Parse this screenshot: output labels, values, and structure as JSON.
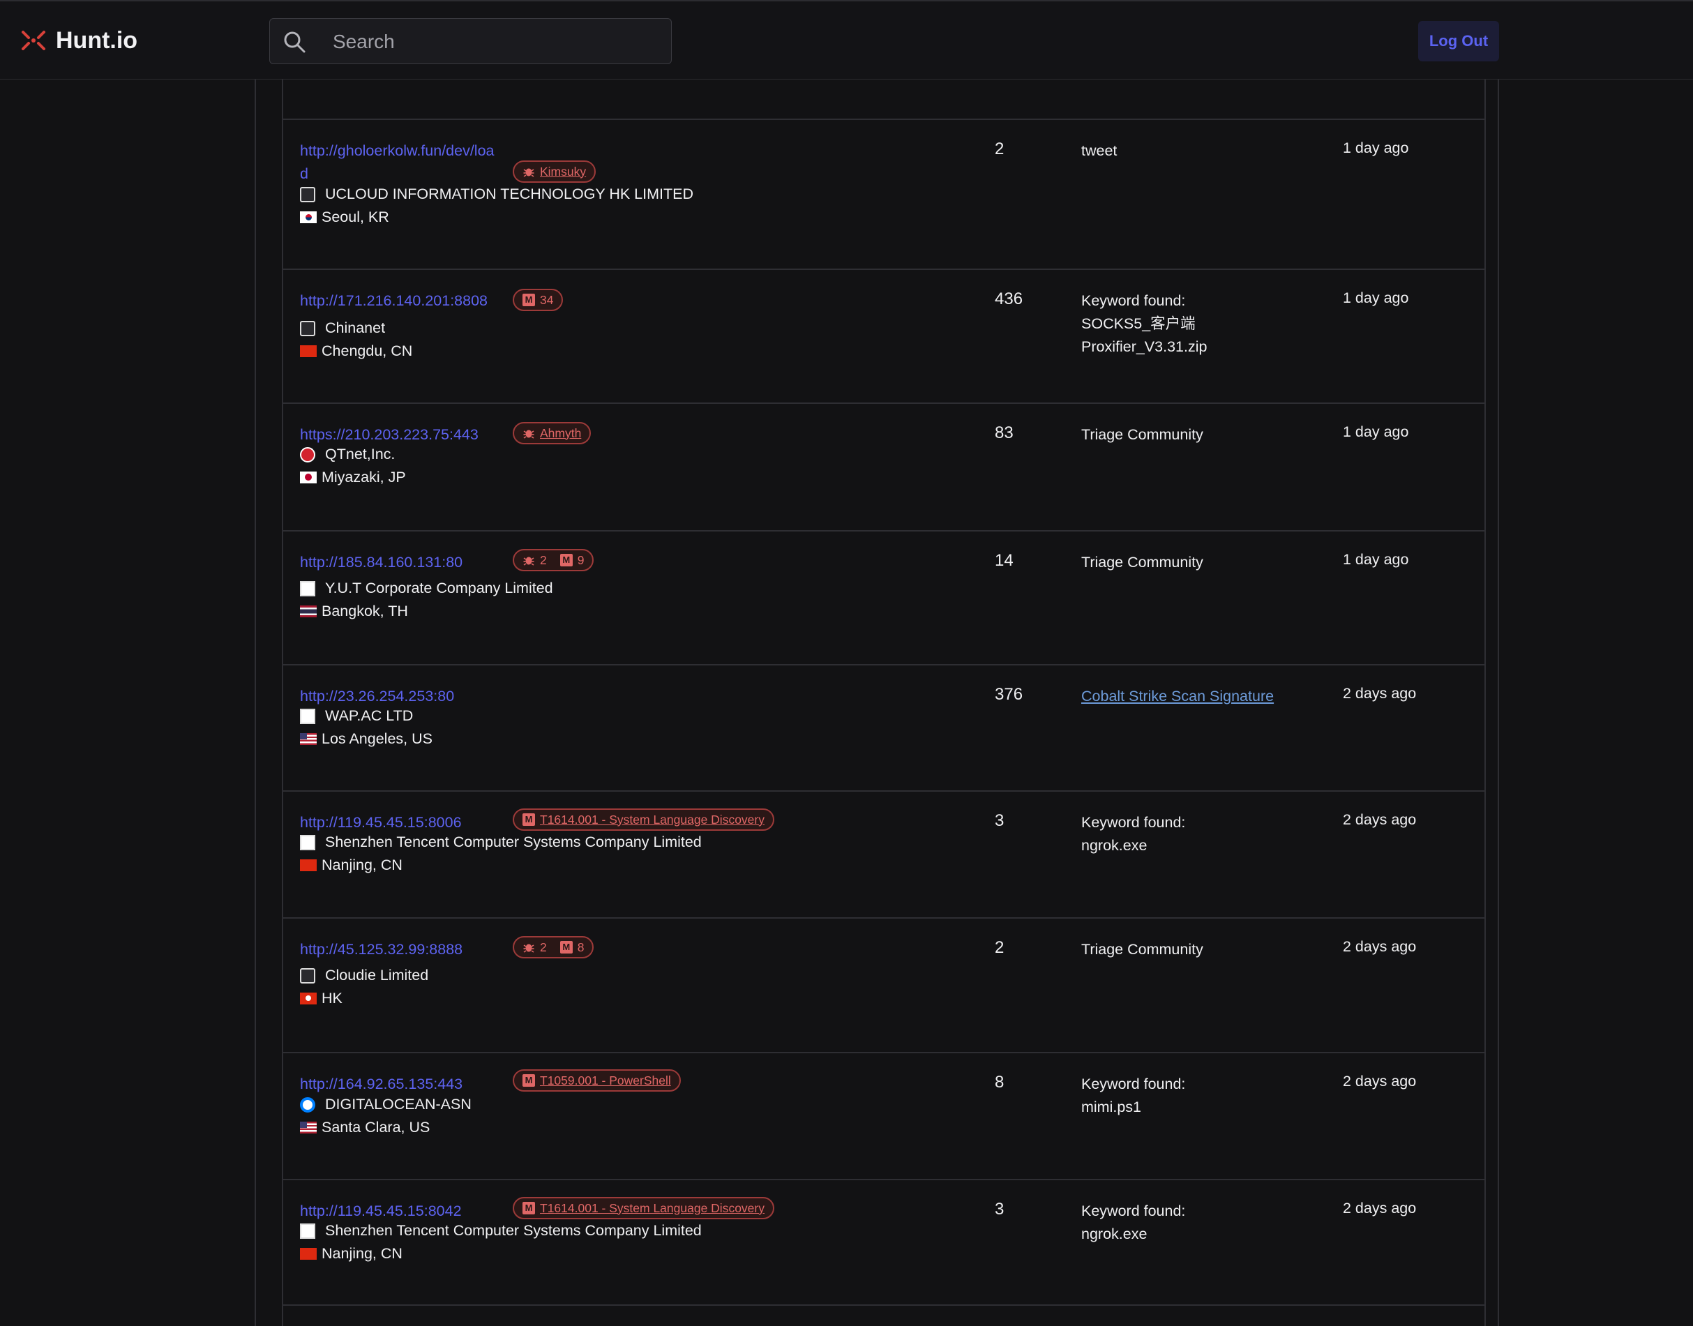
{
  "app": {
    "name": "Hunt.io"
  },
  "search": {
    "placeholder": "Search"
  },
  "header": {
    "logout_label": "Log Out"
  },
  "rows": [
    {
      "url_line1": "http://gholoerkolw.fun/dev/loa",
      "url_line2": "d",
      "badge_label": "Kimsuky",
      "org": "UCLOUD INFORMATION TECHNOLOGY HK LIMITED",
      "location": "Seoul, KR",
      "count": "2",
      "source": "tweet",
      "time": "1 day ago"
    },
    {
      "url": "http://171.216.140.201:8808",
      "badge_count": "34",
      "org": "Chinanet",
      "location": "Chengdu, CN",
      "count": "436",
      "source_line1": "Keyword found:",
      "source_line2": "SOCKS5_客户端",
      "source_line3": "Proxifier_V3.31.zip",
      "time": "1 day ago"
    },
    {
      "url": "https://210.203.223.75:443",
      "badge_label": "Ahmyth",
      "org": "QTnet,Inc.",
      "location": "Miyazaki, JP",
      "count": "83",
      "source": "Triage Community",
      "time": "1 day ago"
    },
    {
      "url": "http://185.84.160.131:80",
      "badge_bug_count": "2",
      "badge_m_count": "9",
      "org": "Y.U.T Corporate Company Limited",
      "location": "Bangkok, TH",
      "count": "14",
      "source": "Triage Community",
      "time": "1 day ago"
    },
    {
      "url": "http://23.26.254.253:80",
      "org": "WAP.AC LTD",
      "location": "Los Angeles, US",
      "count": "376",
      "source_link": "Cobalt Strike Scan Signature",
      "time": "2 days ago"
    },
    {
      "url": "http://119.45.45.15:8006",
      "badge_label": "T1614.001 - System Language Discovery",
      "org": "Shenzhen Tencent Computer Systems Company Limited",
      "location": "Nanjing, CN",
      "count": "3",
      "source_line1": "Keyword found:",
      "source_line2": "ngrok.exe",
      "time": "2 days ago"
    },
    {
      "url": "http://45.125.32.99:8888",
      "badge_bug_count": "2",
      "badge_m_count": "8",
      "org": "Cloudie Limited",
      "location": "HK",
      "count": "2",
      "source": "Triage Community",
      "time": "2 days ago"
    },
    {
      "url": "http://164.92.65.135:443",
      "badge_label": "T1059.001 - PowerShell",
      "org": "DIGITALOCEAN-ASN",
      "location": "Santa Clara, US",
      "count": "8",
      "source_line1": "Keyword found:",
      "source_line2": "mimi.ps1",
      "time": "2 days ago"
    },
    {
      "url": "http://119.45.45.15:8042",
      "badge_label": "T1614.001 - System Language Discovery",
      "org": "Shenzhen Tencent Computer Systems Company Limited",
      "location": "Nanjing, CN",
      "count": "3",
      "source_line1": "Keyword found:",
      "source_line2": "ngrok.exe",
      "time": "2 days ago"
    }
  ],
  "icons": {
    "logo": "hunt-logo-icon",
    "search": "search-icon",
    "bug": "bug-icon",
    "mitre": "mitre-m-icon"
  },
  "colors": {
    "accent": "#5d63f0",
    "badge_red": "#e06766",
    "background": "#121214"
  }
}
